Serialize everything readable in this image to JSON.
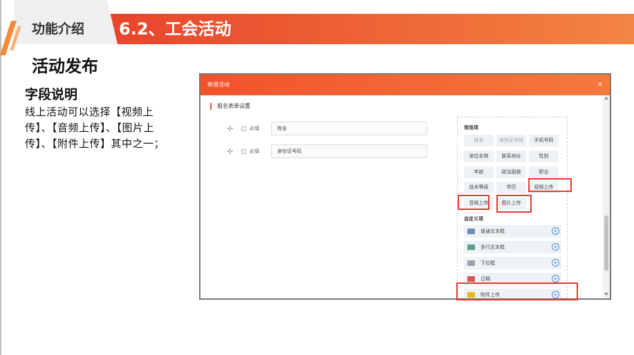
{
  "header": {
    "tab_label": "功能介绍",
    "title": "6.2、工会活动"
  },
  "section": {
    "title": "活动发布",
    "field_title": "字段说明",
    "field_desc": "线上活动可以选择【视频上传】、【音频上传】、【图片上传】、【附件上传】其中之一；"
  },
  "dialog": {
    "title": "新增活动",
    "close": "×",
    "section_label": "报名表单设置",
    "rows": [
      {
        "required_label": "必填",
        "value": "姓名"
      },
      {
        "required_label": "必填",
        "value": "身份证号码"
      }
    ],
    "common_header": "常用项",
    "common_items": [
      "姓名",
      "身份证号码",
      "手机号码",
      "单位名称",
      "联系地址",
      "性别",
      "年龄",
      "政治面貌",
      "职业",
      "技术等级",
      "学历",
      "视频上传",
      "音频上传",
      "图片上传"
    ],
    "custom_header": "自定义项",
    "custom_items": [
      "普通文本框",
      "多行文本框",
      "下拉框",
      "日期",
      "附件上传"
    ],
    "add_icon": "+"
  },
  "colors": {
    "accent": "#f2522c",
    "highlight": "#e8392c"
  }
}
